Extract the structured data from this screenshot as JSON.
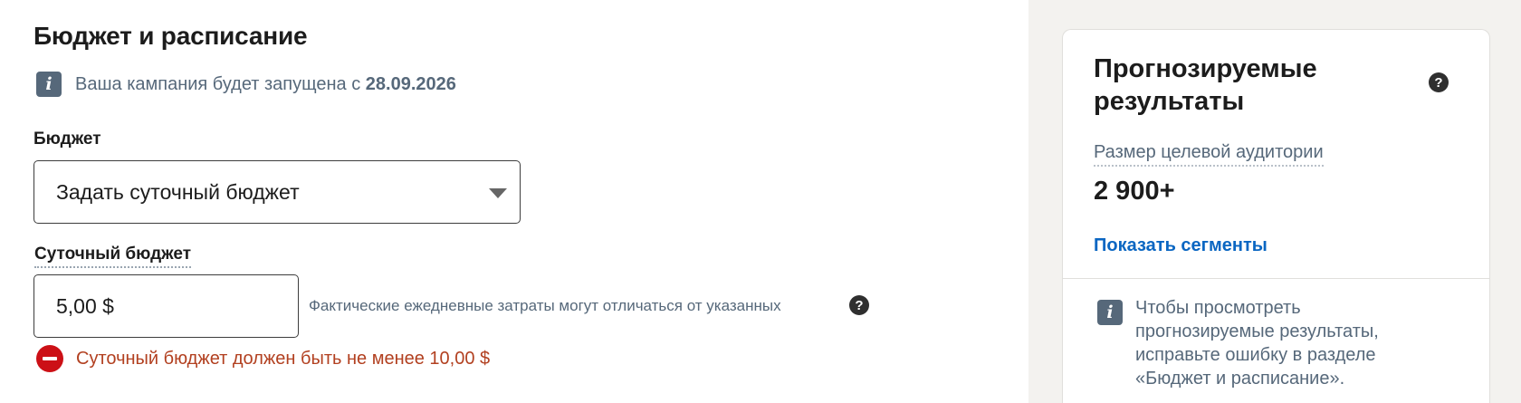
{
  "section": {
    "title": "Бюджет и расписание",
    "info_prefix": "Ваша кампания будет запущена с",
    "launch_date": "28.09.2026",
    "info_icon": "i"
  },
  "budget": {
    "label": "Бюджет",
    "selected": "Задать суточный бюджет",
    "daily_label": "Суточный бюджет",
    "amount": "5,00 $",
    "hint": "Фактические ежедневные затраты могут отличаться от указанных",
    "help_icon": "?",
    "error": "Суточный бюджет должен быть не менее 10,00 $"
  },
  "forecast": {
    "title": "Прогнозируемые результаты",
    "help_icon": "?",
    "audience_label": "Размер целевой аудитории",
    "audience_value": "2 900+",
    "segments_link": "Показать сегменты",
    "info_icon": "i",
    "note": "Чтобы просмотреть прогнозируемые результаты, исправьте ошибку в разделе «Бюджет и расписание»."
  },
  "colors": {
    "error": "#cc1016",
    "link": "#0a66c2",
    "muted_text": "#56687a",
    "side_background": "#f3f2ef"
  }
}
